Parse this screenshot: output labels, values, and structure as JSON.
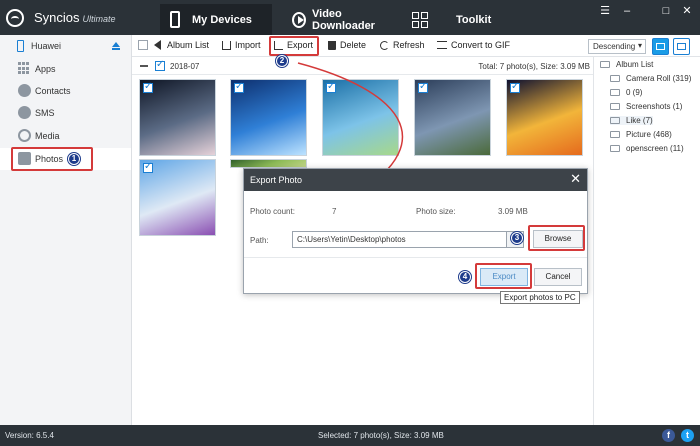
{
  "titlebar": {
    "app_name": "Syncios",
    "app_edition": "Ultimate",
    "tabs": [
      {
        "label": "My Devices",
        "active": true
      },
      {
        "label": "Video Downloader",
        "active": false
      },
      {
        "label": "Toolkit",
        "active": false
      }
    ],
    "window_controls": {
      "menu": "☰",
      "minimize": "–",
      "maximize": "□",
      "close": "✕"
    }
  },
  "sidebar": {
    "device_name": "Huawei",
    "items": [
      {
        "label": "Apps",
        "icon": "apps-icon"
      },
      {
        "label": "Contacts",
        "icon": "contacts-icon"
      },
      {
        "label": "SMS",
        "icon": "sms-icon"
      },
      {
        "label": "Media",
        "icon": "media-icon"
      },
      {
        "label": "Photos",
        "icon": "photos-icon",
        "active": true
      }
    ]
  },
  "toolbar": {
    "album_list": "Album List",
    "import": "Import",
    "export": "Export",
    "delete": "Delete",
    "refresh": "Refresh",
    "convert_gif": "Convert to GIF",
    "sort_value": "Descending"
  },
  "content": {
    "group_date": "2018-07",
    "total": "Total: 7 photo(s), Size: 3.09 MB",
    "photos": [
      {
        "id": "p1",
        "colors": [
          "#0e1524",
          "#5b6b85",
          "#e6d2d9"
        ]
      },
      {
        "id": "p2",
        "colors": [
          "#0d2f6e",
          "#2f7fd6",
          "#bde3ff"
        ]
      },
      {
        "id": "p3",
        "colors": [
          "#1b6fa6",
          "#7dc3e8",
          "#a7d88a"
        ]
      },
      {
        "id": "p4",
        "colors": [
          "#2c3e5a",
          "#7e96b2",
          "#4b6a3a"
        ]
      },
      {
        "id": "p5",
        "colors": [
          "#0d1030",
          "#f2b53a",
          "#e56a1d"
        ]
      },
      {
        "id": "p6",
        "colors": [
          "#5ea5e6",
          "#dfe9f5",
          "#8a4fb2"
        ]
      },
      {
        "id": "p7",
        "colors": [
          "#2f5f2a",
          "#8dbb57",
          "#c4d889"
        ]
      }
    ]
  },
  "albums": {
    "title": "Album List",
    "items": [
      {
        "label": "Camera Roll (319)"
      },
      {
        "label": "0 (9)"
      },
      {
        "label": "Screenshots (1)"
      },
      {
        "label": "Like (7)",
        "selected": true
      },
      {
        "label": "Picture (468)"
      },
      {
        "label": "openscreen (11)"
      }
    ]
  },
  "dialog": {
    "title": "Export Photo",
    "photo_count_label": "Photo count:",
    "photo_count_value": "7",
    "photo_size_label": "Photo size:",
    "photo_size_value": "3.09 MB",
    "path_label": "Path:",
    "path_value": "C:\\Users\\Yetin\\Desktop\\photos",
    "browse": "Browse",
    "export": "Export",
    "cancel": "Cancel",
    "tooltip": "Export photos to PC"
  },
  "annotations": {
    "step1": "1",
    "step2": "2",
    "step3": "3",
    "step4": "4"
  },
  "statusbar": {
    "version": "Version: 6.5.4",
    "selected": "Selected: 7 photo(s), Size: 3.09 MB",
    "facebook": "f",
    "twitter": "t"
  },
  "colors": {
    "titlebar_bg": "#2b3238",
    "accent": "#1a7fd3",
    "highlight_red": "#d43a3a",
    "badge_blue": "#1e3c8c"
  }
}
